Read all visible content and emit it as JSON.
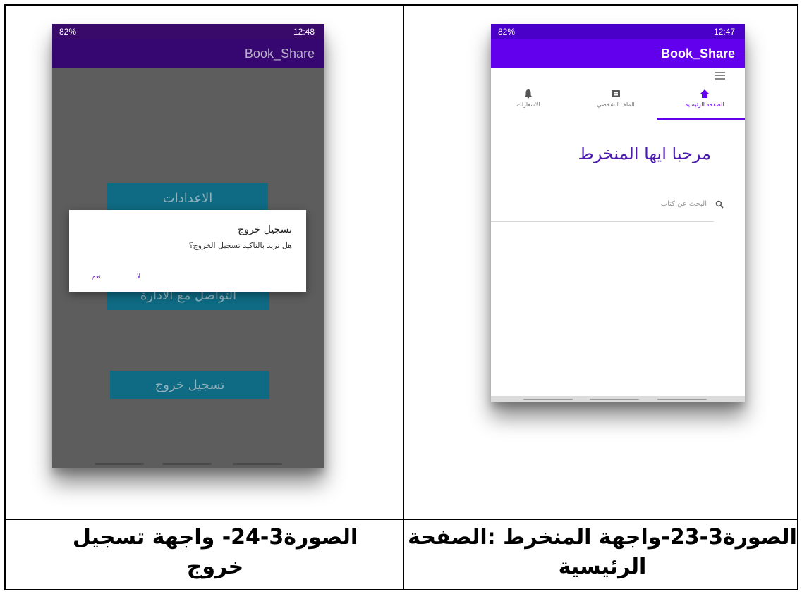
{
  "captions": {
    "left": "الصورة3-24- واجهة تسجيل خروج",
    "right": "الصورة3-23-واجهة المنخرط :الصفحة الرئيسية"
  },
  "logout_screen": {
    "status_left": "82%",
    "status_time": "12:48",
    "app_title": "Book_Share",
    "settings_button": "الاعدادات",
    "contact_button": "التواصل مع الادارة",
    "logout_button": "تسجيل خروج",
    "dialog": {
      "title": "تسجيل خروج",
      "message": "هل تريد بالتاكيد تسجيل الخروج؟",
      "no_label": "لا",
      "yes_label": "نعم"
    }
  },
  "home_screen": {
    "status_left": "82%",
    "status_time": "12:47",
    "app_title": "Book_Share",
    "tabs": {
      "home": "الصفحة الرئيسية",
      "profile": "الملف الشخصي",
      "notifications": "الاشعارات"
    },
    "welcome_text": "مرحبا ايها المنخرط",
    "search_placeholder": "البحث عن كتاب"
  },
  "colors": {
    "primary": "#6200ee",
    "dim_button": "#0f6a83"
  }
}
